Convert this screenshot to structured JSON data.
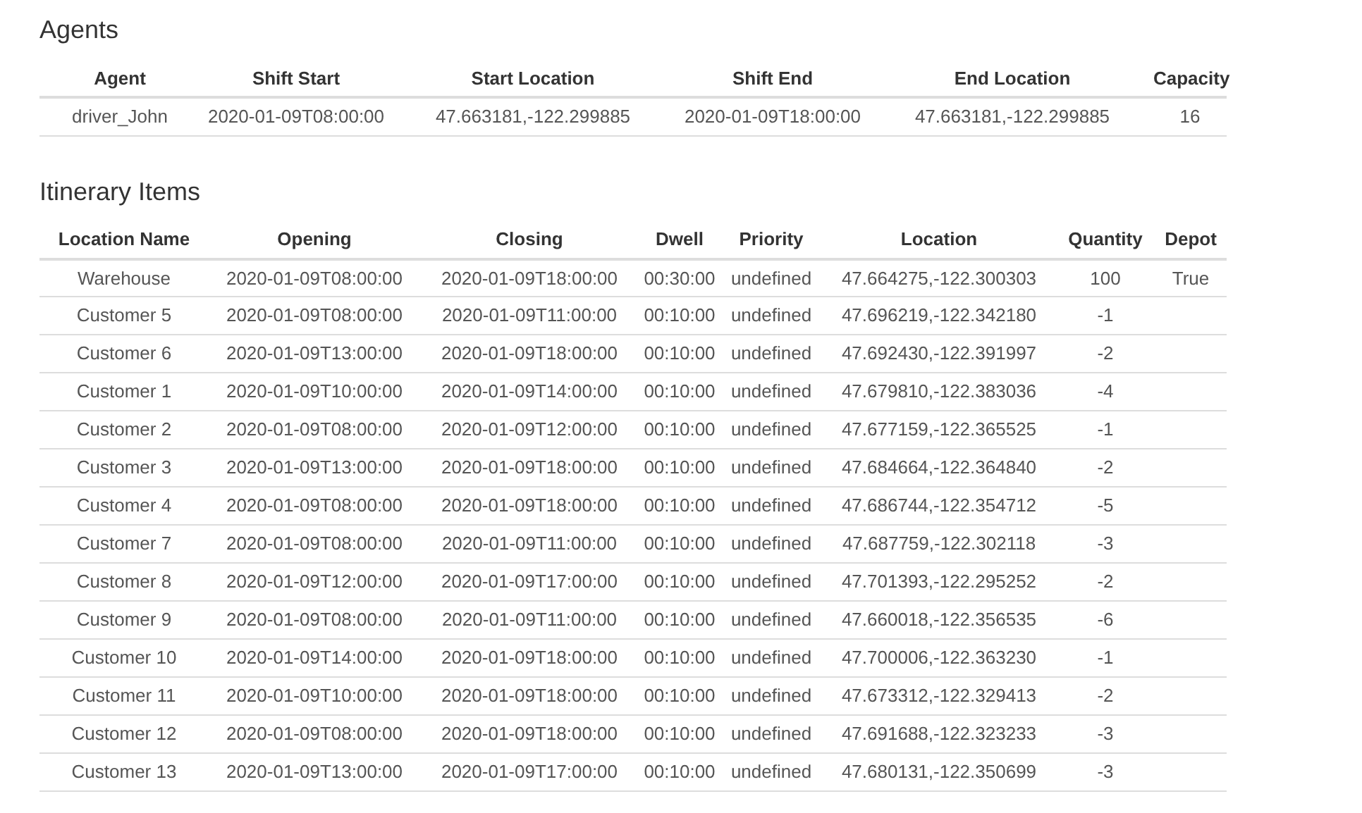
{
  "agents": {
    "title": "Agents",
    "columns": [
      "Agent",
      "Shift Start",
      "Start Location",
      "Shift End",
      "End Location",
      "Capacity"
    ],
    "rows": [
      [
        "driver_John",
        "2020-01-09T08:00:00",
        "47.663181,-122.299885",
        "2020-01-09T18:00:00",
        "47.663181,-122.299885",
        "16"
      ]
    ]
  },
  "itinerary": {
    "title": "Itinerary Items",
    "columns": [
      "Location Name",
      "Opening",
      "Closing",
      "Dwell",
      "Priority",
      "Location",
      "Quantity",
      "Depot"
    ],
    "rows": [
      [
        "Warehouse",
        "2020-01-09T08:00:00",
        "2020-01-09T18:00:00",
        "00:30:00",
        "undefined",
        "47.664275,-122.300303",
        "100",
        "True"
      ],
      [
        "Customer 5",
        "2020-01-09T08:00:00",
        "2020-01-09T11:00:00",
        "00:10:00",
        "undefined",
        "47.696219,-122.342180",
        "-1"
      ],
      [
        "Customer 6",
        "2020-01-09T13:00:00",
        "2020-01-09T18:00:00",
        "00:10:00",
        "undefined",
        "47.692430,-122.391997",
        "-2"
      ],
      [
        "Customer 1",
        "2020-01-09T10:00:00",
        "2020-01-09T14:00:00",
        "00:10:00",
        "undefined",
        "47.679810,-122.383036",
        "-4"
      ],
      [
        "Customer 2",
        "2020-01-09T08:00:00",
        "2020-01-09T12:00:00",
        "00:10:00",
        "undefined",
        "47.677159,-122.365525",
        "-1"
      ],
      [
        "Customer 3",
        "2020-01-09T13:00:00",
        "2020-01-09T18:00:00",
        "00:10:00",
        "undefined",
        "47.684664,-122.364840",
        "-2"
      ],
      [
        "Customer 4",
        "2020-01-09T08:00:00",
        "2020-01-09T18:00:00",
        "00:10:00",
        "undefined",
        "47.686744,-122.354712",
        "-5"
      ],
      [
        "Customer 7",
        "2020-01-09T08:00:00",
        "2020-01-09T11:00:00",
        "00:10:00",
        "undefined",
        "47.687759,-122.302118",
        "-3"
      ],
      [
        "Customer 8",
        "2020-01-09T12:00:00",
        "2020-01-09T17:00:00",
        "00:10:00",
        "undefined",
        "47.701393,-122.295252",
        "-2"
      ],
      [
        "Customer 9",
        "2020-01-09T08:00:00",
        "2020-01-09T11:00:00",
        "00:10:00",
        "undefined",
        "47.660018,-122.356535",
        "-6"
      ],
      [
        "Customer 10",
        "2020-01-09T14:00:00",
        "2020-01-09T18:00:00",
        "00:10:00",
        "undefined",
        "47.700006,-122.363230",
        "-1"
      ],
      [
        "Customer 11",
        "2020-01-09T10:00:00",
        "2020-01-09T18:00:00",
        "00:10:00",
        "undefined",
        "47.673312,-122.329413",
        "-2"
      ],
      [
        "Customer 12",
        "2020-01-09T08:00:00",
        "2020-01-09T18:00:00",
        "00:10:00",
        "undefined",
        "47.691688,-122.323233",
        "-3"
      ],
      [
        "Customer 13",
        "2020-01-09T13:00:00",
        "2020-01-09T17:00:00",
        "00:10:00",
        "undefined",
        "47.680131,-122.350699",
        "-3"
      ]
    ]
  }
}
